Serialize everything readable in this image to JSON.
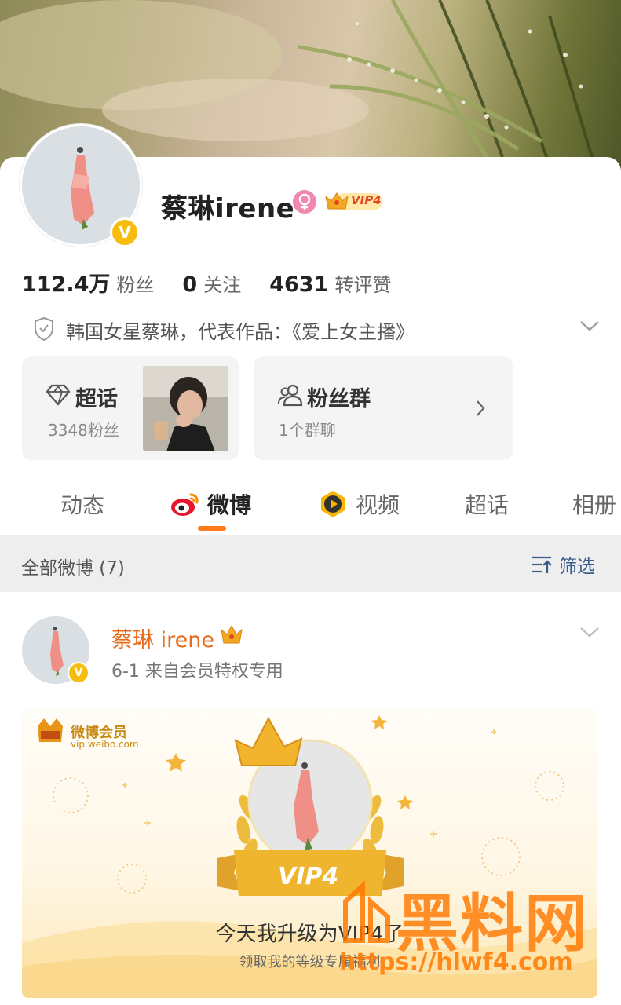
{
  "profile": {
    "name": "蔡琳irene",
    "vip_label": "VIP4",
    "verified_mark": "V",
    "stats": [
      {
        "value": "112.4万",
        "label": "粉丝"
      },
      {
        "value": "0",
        "label": "关注"
      },
      {
        "value": "4631",
        "label": "转评赞"
      }
    ],
    "bio": "韩国女星蔡琳，代表作品：《爱上女主播》"
  },
  "cards": {
    "supertopic": {
      "title": "超话",
      "sub": "3348粉丝"
    },
    "fangroup": {
      "title": "粉丝群",
      "sub": "1个群聊"
    }
  },
  "tabs": [
    {
      "label": "动态"
    },
    {
      "label": "微博"
    },
    {
      "label": "视频"
    },
    {
      "label": "超话"
    },
    {
      "label": "相册"
    }
  ],
  "filter": {
    "count_text": "全部微博 (7)",
    "button": "筛选"
  },
  "post": {
    "name": "蔡琳 irene",
    "meta": "6-1  来自会员特权专用",
    "banner": {
      "logo_text": "微博会员",
      "logo_url": "vip.weibo.com",
      "ribbon": "VIP4",
      "line1": "今天我升级为VIP4了",
      "line2": "领取我的等级专属福利"
    }
  },
  "watermark": {
    "big": "黑料网",
    "url": "https://hlwf4.com"
  },
  "colors": {
    "accent": "#ff7a1a",
    "name_orange": "#e86b1b",
    "verified": "#f6bd10",
    "link_blue": "#3a5b8c"
  },
  "icons": [
    "female-icon",
    "vip-crown-icon",
    "shield-icon",
    "chevron-down-icon",
    "diamond-icon",
    "group-icon",
    "chevron-right-icon",
    "weibo-logo-icon",
    "video-play-icon",
    "filter-icon"
  ]
}
